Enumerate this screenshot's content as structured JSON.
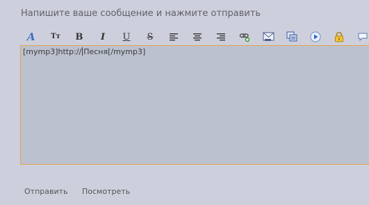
{
  "prompt": "Напишите ваше сообщение и нажмите отправить",
  "toolbar": {
    "font_size_label": "Тт",
    "bold_label": "B",
    "italic_label": "I",
    "underline_label": "U",
    "strike_label": "S"
  },
  "editor": {
    "text_before_caret": "[mymp3]http://",
    "text_after_caret": "Песня[/mymp3]"
  },
  "actions": {
    "send_label": "Отправить",
    "preview_label": "Посмотреть"
  },
  "colors": {
    "background": "#cdd0dc",
    "editor_bg": "#bcc1d0",
    "editor_border": "#e2a44d"
  }
}
